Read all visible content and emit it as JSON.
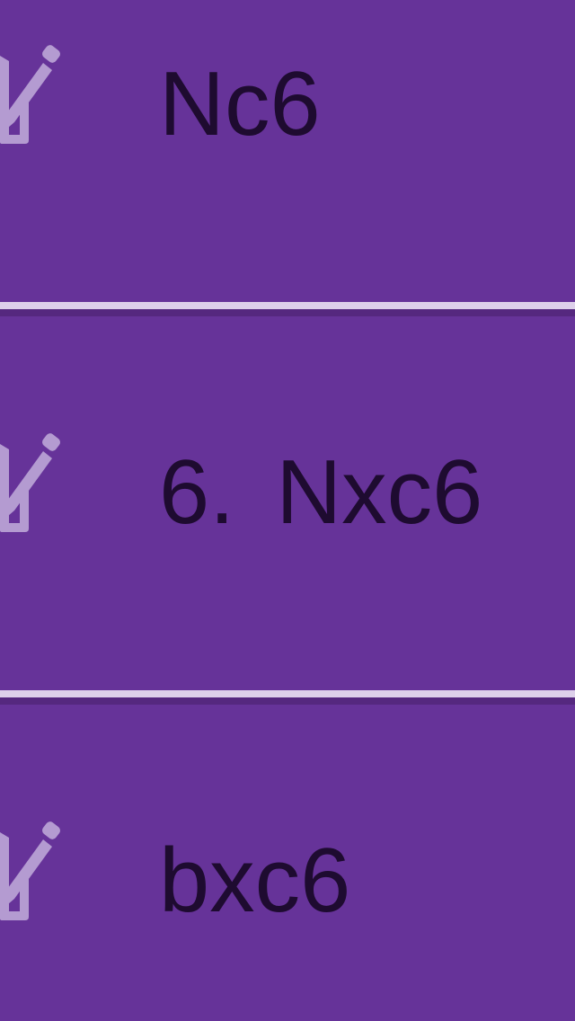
{
  "colors": {
    "background": "#663399",
    "text": "#1e0b30",
    "icon": "#b49bd1",
    "divider_light": "#ddd0ea",
    "divider_dark": "#55287f"
  },
  "moves": [
    {
      "number": "",
      "notation": "Nc6",
      "icon": "edit-icon"
    },
    {
      "number": "6.",
      "notation": "Nxc6",
      "icon": "edit-icon"
    },
    {
      "number": "",
      "notation": "bxc6",
      "icon": "edit-icon"
    }
  ]
}
